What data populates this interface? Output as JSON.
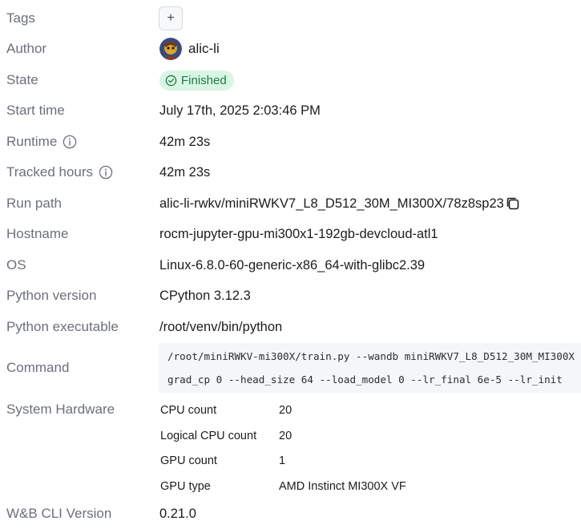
{
  "fields": {
    "tags": {
      "label": "Tags",
      "add_symbol": "+"
    },
    "author": {
      "label": "Author",
      "value": "alic-li"
    },
    "state": {
      "label": "State",
      "value": "Finished"
    },
    "start_time": {
      "label": "Start time",
      "value": "July 17th, 2025 2:03:46 PM"
    },
    "runtime": {
      "label": "Runtime",
      "value": "42m 23s"
    },
    "tracked_hours": {
      "label": "Tracked hours",
      "value": "42m 23s"
    },
    "run_path": {
      "label": "Run path",
      "value": "alic-li-rwkv/miniRWKV7_L8_D512_30M_MI300X/78z8sp23"
    },
    "hostname": {
      "label": "Hostname",
      "value": "rocm-jupyter-gpu-mi300x1-192gb-devcloud-atl1"
    },
    "os": {
      "label": "OS",
      "value": "Linux-6.8.0-60-generic-x86_64-with-glibc2.39"
    },
    "python_version": {
      "label": "Python version",
      "value": "CPython 3.12.3"
    },
    "python_executable": {
      "label": "Python executable",
      "value": "/root/venv/bin/python"
    },
    "command": {
      "label": "Command",
      "lines": [
        "/root/miniRWKV-mi300X/train.py --wandb miniRWKV7_L8_D512_30M_MI300X",
        "grad_cp 0 --head_size 64 --load_model 0 --lr_final 6e-5 --lr_init"
      ]
    },
    "system_hardware": {
      "label": "System Hardware",
      "rows": [
        {
          "key": "CPU count",
          "value": "20"
        },
        {
          "key": "Logical CPU count",
          "value": "20"
        },
        {
          "key": "GPU count",
          "value": "1"
        },
        {
          "key": "GPU type",
          "value": "AMD Instinct MI300X VF"
        }
      ]
    },
    "cli_version": {
      "label": "W&B CLI Version",
      "value": "0.21.0"
    }
  },
  "icons": {
    "info": "info-icon",
    "copy": "copy-icon",
    "status": "check-circle-icon",
    "add": "plus-icon"
  },
  "colors": {
    "label": "#6b7079",
    "text": "#1a1c1f",
    "badge_bg": "#d9f5e3",
    "badge_text": "#1d7a45",
    "code_bg": "#f5f6f7"
  }
}
